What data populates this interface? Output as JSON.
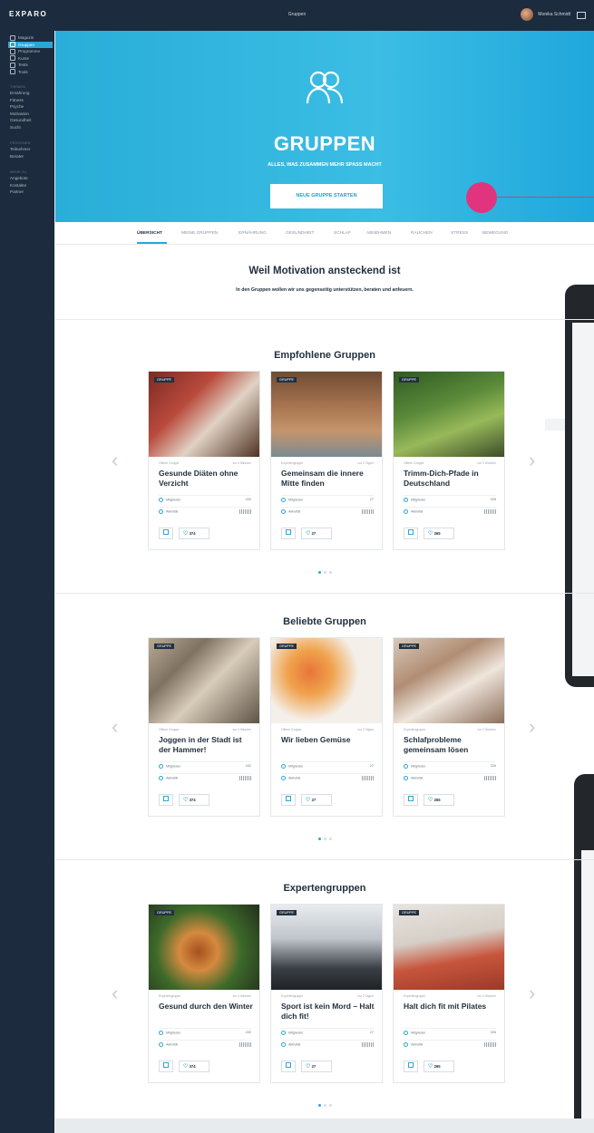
{
  "app": {
    "logo": "EXPARO",
    "page_title": "Gruppen",
    "user_name": "Monika Schmidt"
  },
  "sidebar": {
    "items": [
      {
        "label": "Magazin",
        "active": false
      },
      {
        "label": "Gruppen",
        "active": true
      },
      {
        "label": "Programme",
        "active": false
      },
      {
        "label": "Kurse",
        "active": false
      },
      {
        "label": "Tests",
        "active": false
      },
      {
        "label": "Tools",
        "active": false
      }
    ],
    "sections": [
      {
        "heading": "THEMEN",
        "links": [
          "Ernährung",
          "Fitness",
          "Psyche",
          "Motivation",
          "Gesundheit",
          "Sucht"
        ]
      },
      {
        "heading": "PERSONEN",
        "links": [
          "Teilnehmer",
          "Berater"
        ]
      },
      {
        "heading": "MEHR ZU",
        "links": [
          "Angebote",
          "Kontakte",
          "Partner"
        ]
      }
    ]
  },
  "hero": {
    "title": "GRUPPEN",
    "subtitle": "ALLES, WAS ZUSAMMEN MEHR SPASS MACHT",
    "cta": "NEUE GRUPPE STARTEN",
    "accent": "#2aaedb"
  },
  "tabs": [
    "ÜBERSICHT",
    "MEINE GRUPPEN",
    "ERNÄHRUNG",
    "GESUNDHEIT",
    "SCHLAF",
    "ABNEHMEN",
    "RAUCHEN",
    "STRESS",
    "BEWEGUNG"
  ],
  "intro": {
    "title": "Weil Motivation ansteckend ist",
    "text": "In den Gruppen wollen wir uns gegenseitig unterstützen, beraten und anfeuern."
  },
  "labels": {
    "members": "Mitglieder",
    "activity": "Aktivität",
    "badge": "GRUPPE"
  },
  "sections": [
    {
      "title": "Empfohlene Gruppen",
      "cards": [
        {
          "type": "Offene Gruppe",
          "time": "vor 4 Minuten",
          "title": "Gesunde Diäten ohne Verzicht",
          "members": "432",
          "likes": "374"
        },
        {
          "type": "Expertengruppe",
          "time": "vor 2 Tagen",
          "title": "Gemeinsam die innere Mitte finden",
          "members": "27",
          "likes": "27"
        },
        {
          "type": "Offene Gruppe",
          "time": "vor 2 Wochen",
          "title": "Trimm-Dich-Pfade in Deutschland",
          "members": "326",
          "likes": "265"
        }
      ]
    },
    {
      "title": "Beliebte Gruppen",
      "cards": [
        {
          "type": "Offene Gruppe",
          "time": "vor 4 Minuten",
          "title": "Joggen in der Stadt ist der Hammer!",
          "members": "432",
          "likes": "374"
        },
        {
          "type": "Offene Gruppe",
          "time": "vor 2 Tagen",
          "title": "Wir lieben Gemüse",
          "members": "27",
          "likes": "27"
        },
        {
          "type": "Expertengruppe",
          "time": "vor 2 Wochen",
          "title": "Schlafprobleme gemeinsam lösen",
          "members": "326",
          "likes": "265"
        }
      ]
    },
    {
      "title": "Expertengruppen",
      "cards": [
        {
          "type": "Expertengruppe",
          "time": "vor 4 Minuten",
          "title": "Gesund durch den Winter",
          "members": "432",
          "likes": "374"
        },
        {
          "type": "Expertengruppe",
          "time": "vor 2 Tagen",
          "title": "Sport ist kein Mord – Halt dich fit!",
          "members": "27",
          "likes": "27"
        },
        {
          "type": "Expertengruppe",
          "time": "vor 2 Wochen",
          "title": "Halt dich fit mit Pilates",
          "members": "326",
          "likes": "265"
        }
      ]
    }
  ]
}
